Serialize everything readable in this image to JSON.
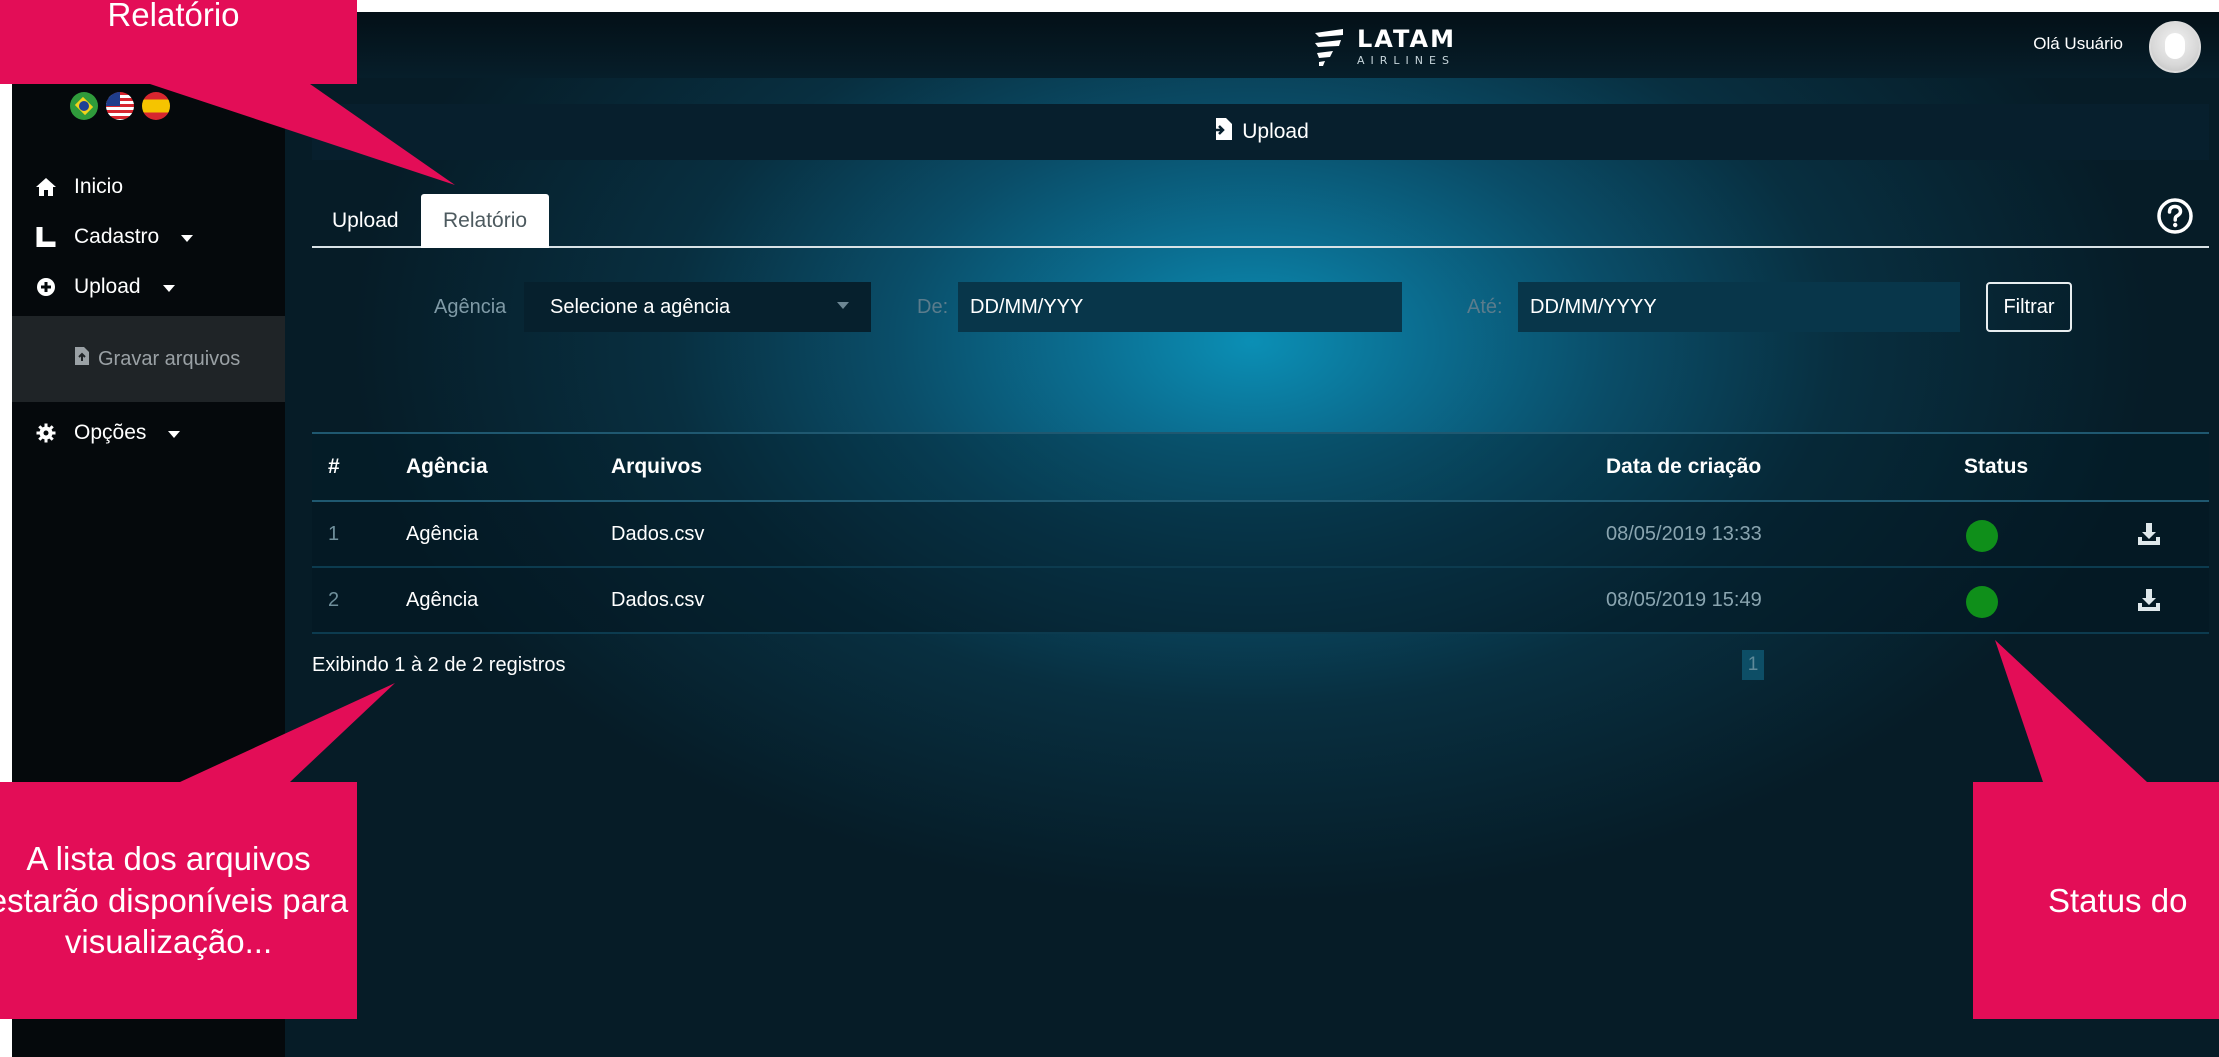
{
  "colors": {
    "callout": "#e30d57",
    "status_ok": "#0f8f1a",
    "sidebar": "#05090c"
  },
  "header": {
    "logo_name": "LATAM",
    "logo_sub": "AIRLINES",
    "greeting": "Olá Usuário"
  },
  "sidebar": {
    "flags": [
      "brazil-flag-icon",
      "usa-flag-icon",
      "spain-flag-icon"
    ],
    "items": [
      {
        "label": "Inicio",
        "icon": "home-icon"
      },
      {
        "label": "Cadastro",
        "icon": "book-icon"
      },
      {
        "label": "Upload",
        "icon": "plus-circle-icon"
      },
      {
        "label": "Gravar arquivos",
        "icon": "file-upload-icon"
      },
      {
        "label": "Opções",
        "icon": "gear-icon"
      }
    ]
  },
  "page": {
    "title": "Upload",
    "tabs": [
      {
        "label": "Upload",
        "active": false
      },
      {
        "label": "Relatório",
        "active": true
      }
    ]
  },
  "filters": {
    "agency_label": "Agência",
    "agency_value": "Selecione a agência",
    "from_label": "De:",
    "from_value": "DD/MM/YYY",
    "to_label": "Até:",
    "to_value": "DD/MM/YYYY",
    "filter_button": "Filtrar"
  },
  "table": {
    "columns": [
      "#",
      "Agência",
      "Arquivos",
      "Data de criação",
      "Status"
    ],
    "rows": [
      {
        "num": "1",
        "agency": "Agência",
        "file": "Dados.csv",
        "date": "08/05/2019 13:33"
      },
      {
        "num": "2",
        "agency": "Agência",
        "file": "Dados.csv",
        "date": "08/05/2019 15:49"
      }
    ],
    "summary": "Exibindo 1 à 2 de 2 registros",
    "page": "1"
  },
  "callouts": {
    "top": "Relatório",
    "left": "A lista dos arquivos estarão disponíveis para visualização...",
    "right": "Status do"
  }
}
